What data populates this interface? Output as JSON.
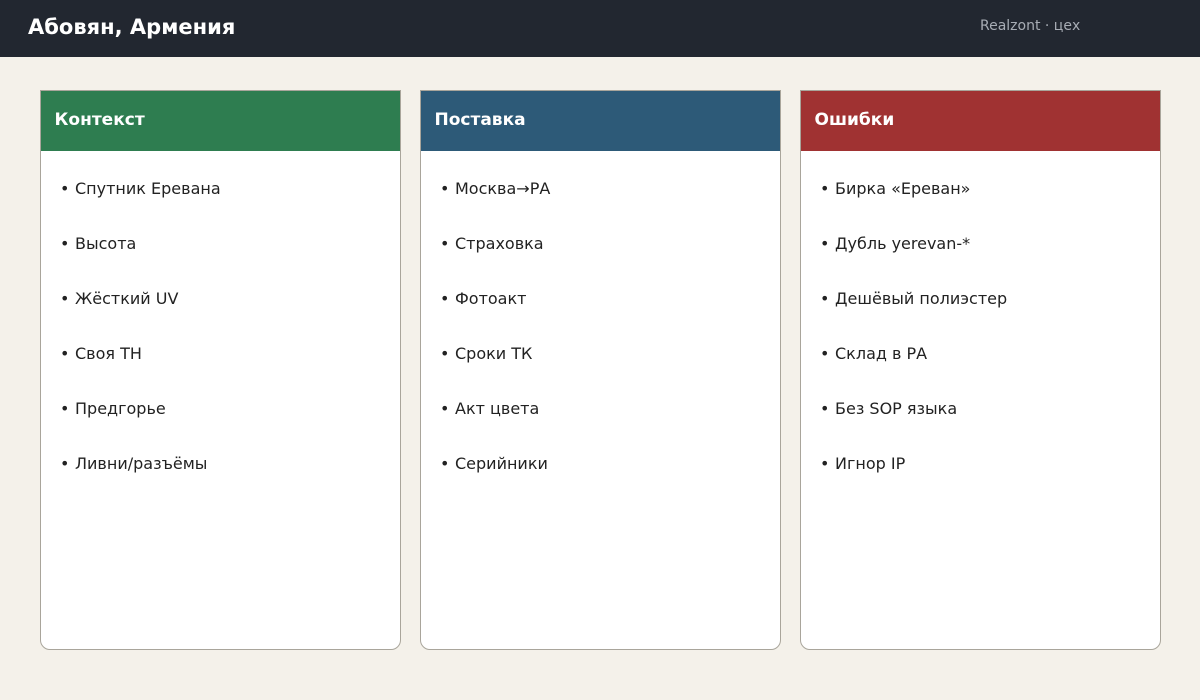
{
  "header": {
    "title": "Абовян, Армения",
    "meta": "Realzont · цех"
  },
  "colors": {
    "header_bg": "#222730",
    "page_bg": "#f4f1ea",
    "context": "#2e7d50",
    "supply": "#2d5a78",
    "errors": "#a03232"
  },
  "columns": [
    {
      "title": "Контекст",
      "items": [
        "Спутник Еревана",
        "Высота",
        "Жёсткий UV",
        "Своя ТН",
        "Предгорье",
        "Ливни/разъёмы"
      ]
    },
    {
      "title": "Поставка",
      "items": [
        "Москва→РА",
        "Страховка",
        "Фотоакт",
        "Сроки ТК",
        "Акт цвета",
        "Серийники"
      ]
    },
    {
      "title": "Ошибки",
      "items": [
        "Бирка «Ереван»",
        "Дубль yerevan-*",
        "Дешёвый полиэстер",
        "Склад в РА",
        "Без SOP языка",
        "Игнор IP"
      ]
    }
  ]
}
